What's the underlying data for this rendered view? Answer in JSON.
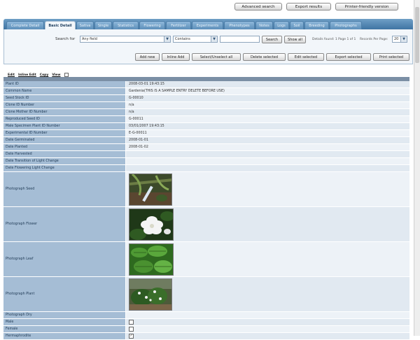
{
  "top_buttons": {
    "advanced_search": "Advanced search",
    "export_results": "Export results",
    "printer_friendly": "Printer-friendly version"
  },
  "tabs": [
    {
      "label": "Complete Detail",
      "active": false
    },
    {
      "label": "Basic Detail",
      "active": true
    },
    {
      "label": "Sativa",
      "active": false
    },
    {
      "label": "Single",
      "active": false
    },
    {
      "label": "Statistics",
      "active": false
    },
    {
      "label": "Flowering",
      "active": false
    },
    {
      "label": "Fertilizer",
      "active": false
    },
    {
      "label": "Experiments",
      "active": false
    },
    {
      "label": "Phenotypes",
      "active": false
    },
    {
      "label": "Notes",
      "active": false
    },
    {
      "label": "Logs",
      "active": false
    },
    {
      "label": "Soil",
      "active": false
    },
    {
      "label": "Breeding",
      "active": false
    },
    {
      "label": "Photographs",
      "active": false
    }
  ],
  "search": {
    "label": "Search for",
    "field_value": "Any field",
    "operator_value": "Contains",
    "query_value": "",
    "search_button": "Search",
    "show_all_button": "Show all",
    "details_found": "Details found: 1  Page 1 of 1",
    "records_per_page_label": "Records Per Page:",
    "records_per_page_value": "20"
  },
  "actions": {
    "add_new": "Add new",
    "inline_add": "Inline Add",
    "select_unselect_all": "Select/Unselect all",
    "delete_selected": "Delete selected",
    "edit_selected": "Edit selected",
    "export_selected": "Export selected",
    "print_selected": "Print selected"
  },
  "record_links": {
    "edit": "Edit",
    "inline_edit": "Inline Edit",
    "copy": "Copy",
    "view": "View"
  },
  "record": {
    "plant_id": {
      "label": "Plant ID",
      "value": "2008-03-01 19:43:15"
    },
    "common_name": {
      "label": "Common Name",
      "value": "Gardenia(THIS IS A SAMPLE ENTRY DELETE BEFORE USE)"
    },
    "seed_stock_id": {
      "label": "Seed Stock ID",
      "value": "G-00010"
    },
    "clone_id": {
      "label": "Clone ID Number",
      "value": "n/a"
    },
    "clone_mother_id": {
      "label": "Clone Mother ID Number",
      "value": "n/a"
    },
    "reproduced_seed_id": {
      "label": "Reproduced Seed ID",
      "value": "G-00011"
    },
    "male_specimen_id": {
      "label": "Male Specimen Plant ID Number",
      "value": "03/01/2007 19:43:15"
    },
    "experimental_id": {
      "label": "Experimental ID Number",
      "value": "E-G-00011"
    },
    "date_germinated": {
      "label": "Date Germinated",
      "value": "2008-01-01"
    },
    "date_planted": {
      "label": "Date Planted",
      "value": "2008-01-02"
    },
    "date_harvested": {
      "label": "Date Harvested",
      "value": ""
    },
    "date_transition": {
      "label": "Date Transition of Light Change",
      "value": ""
    },
    "date_flowering": {
      "label": "Date Flowering Light Change",
      "value": ""
    },
    "photo_seed": {
      "label": "Photograph Seed"
    },
    "photo_flower": {
      "label": "Photograph Flower"
    },
    "photo_leaf": {
      "label": "Photograph Leaf"
    },
    "photo_plant": {
      "label": "Photograph Plant"
    },
    "photo_dry": {
      "label": "Photograph Dry"
    },
    "male": {
      "label": "Male",
      "checked": false
    },
    "female": {
      "label": "Female",
      "checked": false
    },
    "hermaphrodite": {
      "label": "Hermaphrodite",
      "checked": true
    }
  },
  "colors": {
    "tab_bar": "#4f83b0",
    "label_cell": "#a5bdd5",
    "value_cell": "#e1e9f1",
    "panel_bg": "#f2f6fa"
  }
}
